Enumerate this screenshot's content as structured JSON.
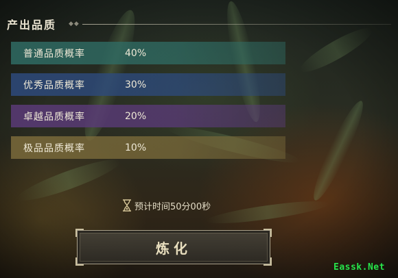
{
  "header": {
    "title": "产出品质"
  },
  "quality_rows": [
    {
      "label": "普通品质概率",
      "value": "40%",
      "color": "#2f6b63"
    },
    {
      "label": "优秀品质概率",
      "value": "30%",
      "color": "#2d4a7c"
    },
    {
      "label": "卓越品质概率",
      "value": "20%",
      "color": "#5a3a78"
    },
    {
      "label": "极品品质概率",
      "value": "10%",
      "color": "#7a6a3a"
    }
  ],
  "timer": {
    "icon": "hourglass-icon",
    "text": "预计时间50分00秒"
  },
  "refine_button": {
    "label": "炼化"
  },
  "watermark": {
    "text": "Eassk.Net",
    "color": "#29e04a"
  }
}
